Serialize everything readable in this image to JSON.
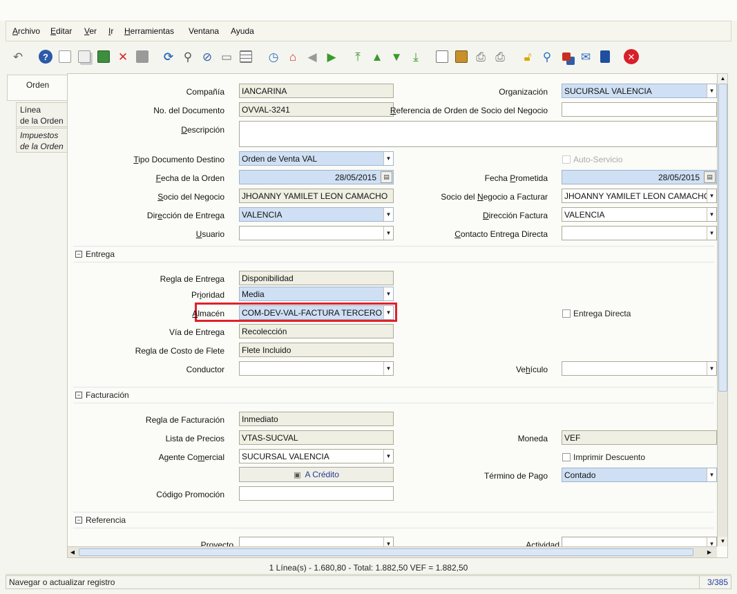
{
  "menu": [
    {
      "mn": "A",
      "rest": "rchivo"
    },
    {
      "mn": "E",
      "rest": "ditar"
    },
    {
      "mn": "V",
      "rest": "er"
    },
    {
      "mn": "I",
      "rest": "r"
    },
    {
      "mn": "H",
      "rest": "erramientas"
    },
    {
      "mn": "",
      "rest": "Ventana"
    },
    {
      "mn": "",
      "rest": "Ayuda"
    }
  ],
  "toolbar_icons": [
    "undo-icon",
    "help-icon",
    "new-record-icon",
    "copy-record-icon",
    "delete-selection-icon",
    "delete-record-icon",
    "save-icon",
    "refresh-icon",
    "find-icon",
    "attachment-icon",
    "chat-icon",
    "grid-toggle-icon",
    "history-icon",
    "home-icon",
    "previous-tab-icon",
    "next-tab-icon",
    "first-record-icon",
    "previous-record-icon",
    "next-record-icon",
    "last-record-icon",
    "report-icon",
    "archive-icon",
    "print-preview-icon",
    "print-icon",
    "lock-icon",
    "zoom-across-icon",
    "workflow-icon",
    "request-icon",
    "product-info-icon",
    "end-icon"
  ],
  "tabs": {
    "active": "Orden",
    "line": "Línea\nde la Orden",
    "taxes": "Impuestos\nde la Orden"
  },
  "fields": {
    "company": {
      "label": "Compañía",
      "value": "IANCARINA"
    },
    "organization": {
      "label": "Organización",
      "value": "SUCURSAL VALENCIA"
    },
    "doc_no": {
      "label": "No. del Documento",
      "value": "OVVAL-3241"
    },
    "bp_order_ref": {
      "label_mn": "R",
      "label_rest": "eferencia de Orden de Socio del Negocio",
      "value": ""
    },
    "description": {
      "label_mn": "D",
      "label_rest": "escripción",
      "value": ""
    },
    "target_doc_type": {
      "label_mn": "T",
      "label_rest": "ipo Documento Destino",
      "value": "Orden de Venta VAL"
    },
    "self_service": {
      "label": "Auto-Servicio"
    },
    "order_date": {
      "label_mn": "F",
      "label_rest": "echa de la Orden",
      "value": "28/05/2015"
    },
    "promised_date": {
      "label_pre": "Fecha ",
      "label_mn": "P",
      "label_rest": "rometida",
      "value": "28/05/2015"
    },
    "business_partner": {
      "label_mn": "S",
      "label_rest": "ocio del Negocio",
      "value": "JHOANNY YAMILET LEON CAMACHO"
    },
    "bill_partner": {
      "label_pre": "Socio del ",
      "label_mn": "N",
      "label_rest": "egocio a Facturar",
      "value": "JHOANNY YAMILET LEON CAMACHO"
    },
    "delivery_address": {
      "label_pre": "Dir",
      "label_mn": "e",
      "label_rest": "cción de Entrega",
      "value": "VALENCIA"
    },
    "invoice_address": {
      "label_mn": "D",
      "label_rest": "irección Factura",
      "value": "VALENCIA"
    },
    "user": {
      "label_mn": "U",
      "label_rest": "suario",
      "value": ""
    },
    "drop_ship_contact": {
      "label_mn": "C",
      "label_rest": "ontacto Entrega Directa",
      "value": ""
    },
    "delivery_rule": {
      "label": "Regla de Entrega",
      "value": "Disponibilidad"
    },
    "priority": {
      "label_pre": "Pr",
      "label_mn": "i",
      "label_rest": "oridad",
      "value": "Media"
    },
    "warehouse": {
      "label_mn": "A",
      "label_rest": "lmacén",
      "value": "COM-DEV-VAL-FACTURA TERCERO"
    },
    "drop_ship": {
      "label": "Entrega Directa"
    },
    "delivery_via": {
      "label": "Vía de Entrega",
      "value": "Recolección"
    },
    "freight_cost_rule": {
      "label": "Regla de Costo de Flete",
      "value": "Flete Incluido"
    },
    "driver": {
      "label": "Conductor",
      "value": ""
    },
    "vehicle": {
      "label_pre": "Ve",
      "label_mn": "h",
      "label_rest": "ículo",
      "value": ""
    },
    "invoice_rule": {
      "label": "Regla de Facturación",
      "value": "Inmediato"
    },
    "price_list": {
      "label": "Lista de Precios",
      "value": "VTAS-SUCVAL"
    },
    "currency": {
      "label": "Moneda",
      "value": "VEF"
    },
    "sales_rep": {
      "label_pre": "Agente Co",
      "label_mn": "m",
      "label_rest": "ercial",
      "value": "SUCURSAL VALENCIA"
    },
    "print_discount": {
      "label": "Imprimir Descuento"
    },
    "credit_button": {
      "label": "A Crédito"
    },
    "payment_term": {
      "label": "Término de Pago",
      "value": "Contado"
    },
    "promo_code": {
      "label": "Código Promoción",
      "value": ""
    },
    "project": {
      "label": "Proyecto",
      "value": ""
    },
    "activity": {
      "label": "Actividad",
      "value": ""
    }
  },
  "sections": {
    "delivery": "Entrega",
    "invoicing": "Facturación",
    "reference": "Referencia"
  },
  "status": {
    "summary": "1 Línea(s) - 1.680,80 -  Total: 1.882,50  VEF =  1.882,50",
    "message": "Navegar o actualizar registro",
    "record_count": "3/385"
  },
  "colors": {
    "required_field": "#cfe0f4",
    "readonly_field": "#efefe3",
    "highlight": "#e0202a"
  }
}
